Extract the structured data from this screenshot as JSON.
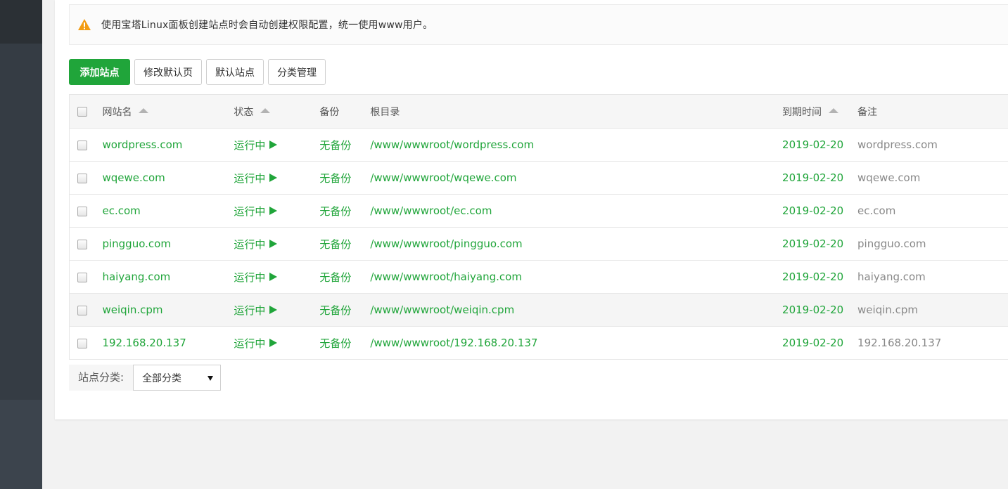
{
  "notice": {
    "text": "使用宝塔Linux面板创建站点时会自动创建权限配置，统一使用www用户。",
    "icon": "warning-icon",
    "icon_color": "#f39c12"
  },
  "toolbar": {
    "add_site_label": "添加站点",
    "edit_default_page_label": "修改默认页",
    "default_site_label": "默认站点",
    "category_manage_label": "分类管理"
  },
  "table": {
    "headers": {
      "site_name": "网站名",
      "status": "状态",
      "backup": "备份",
      "root_dir": "根目录",
      "expire": "到期时间",
      "remark": "备注"
    },
    "rows": [
      {
        "name": "wordpress.com",
        "status": "运行中",
        "backup": "无备份",
        "root": "/www/wwwroot/wordpress.com",
        "expire": "2019-02-20",
        "remark": "wordpress.com"
      },
      {
        "name": "wqewe.com",
        "status": "运行中",
        "backup": "无备份",
        "root": "/www/wwwroot/wqewe.com",
        "expire": "2019-02-20",
        "remark": "wqewe.com"
      },
      {
        "name": "ec.com",
        "status": "运行中",
        "backup": "无备份",
        "root": "/www/wwwroot/ec.com",
        "expire": "2019-02-20",
        "remark": "ec.com"
      },
      {
        "name": "pingguo.com",
        "status": "运行中",
        "backup": "无备份",
        "root": "/www/wwwroot/pingguo.com",
        "expire": "2019-02-20",
        "remark": "pingguo.com"
      },
      {
        "name": "haiyang.com",
        "status": "运行中",
        "backup": "无备份",
        "root": "/www/wwwroot/haiyang.com",
        "expire": "2019-02-20",
        "remark": "haiyang.com"
      },
      {
        "name": "weiqin.cpm",
        "status": "运行中",
        "backup": "无备份",
        "root": "/www/wwwroot/weiqin.cpm",
        "expire": "2019-02-20",
        "remark": "weiqin.cpm"
      },
      {
        "name": "192.168.20.137",
        "status": "运行中",
        "backup": "无备份",
        "root": "/www/wwwroot/192.168.20.137",
        "expire": "2019-02-20",
        "remark": "192.168.20.137"
      }
    ]
  },
  "filter": {
    "label": "站点分类:",
    "selected": "全部分类"
  },
  "colors": {
    "accent": "#20a53a",
    "sidebar": "#3c444d"
  }
}
